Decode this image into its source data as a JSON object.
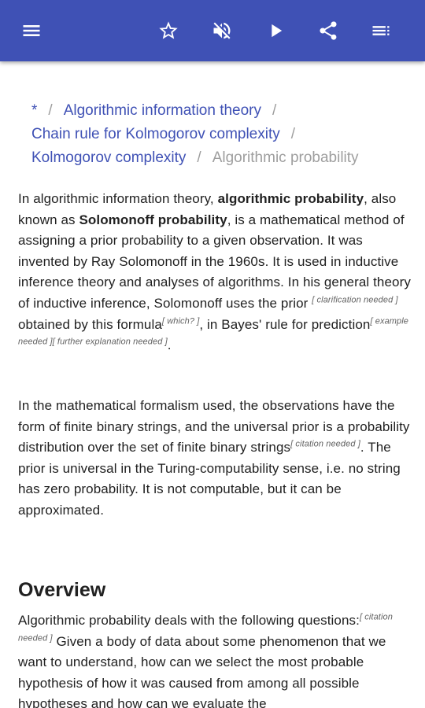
{
  "toolbar": {
    "icons": [
      "menu-icon",
      "star-icon",
      "volume-off-icon",
      "play-icon",
      "share-icon",
      "toc-icon"
    ]
  },
  "breadcrumb": {
    "items": [
      "*",
      "Algorithmic information theory",
      "Chain rule for Kolmogorov complexity",
      "Kolmogorov complexity"
    ],
    "current": "Algorithmic probability",
    "separator": "/"
  },
  "article": {
    "p1": {
      "t1": "In algorithmic information theory, ",
      "b1": "algorithmic probability",
      "t2": ", also known as ",
      "b2": "Solomonoff probability",
      "t3": ", is a mathematical method of assigning a prior probability to a given observation. It was invented by Ray Solomonoff in the 1960s. It is used in inductive inference theory and analyses of algorithms. In his general theory of inductive inference, Solomonoff uses the prior ",
      "n1": "[ clarification needed ]",
      "t4": " obtained by this formula",
      "n2": "[ which? ]",
      "t5": ", in Bayes' rule for prediction",
      "n3": "[ example needed ][ further explanation needed ]",
      "t6": "."
    },
    "p2": {
      "t1": "In the mathematical formalism used, the observations have the form of finite binary strings, and the universal prior is a probability distribution over the set of finite binary strings",
      "n1": "[ citation needed ]",
      "t2": ". The prior is universal in the Turing-computability sense, i.e. no string has zero probability. It is not computable, but it can be approximated."
    },
    "overview_heading": "Overview",
    "p3": {
      "t1": "Algorithmic probability deals with the following questions:",
      "n1": "[ citation needed ]",
      "t2": " Given a body of data about some phenomenon that we want to understand, how can we select the most probable hypothesis of how it was caused from among all possible hypotheses and how can we evaluate the"
    }
  },
  "colors": {
    "appbar": "#3f51b5",
    "link": "#3f51b5",
    "muted": "#9e9e9e"
  }
}
